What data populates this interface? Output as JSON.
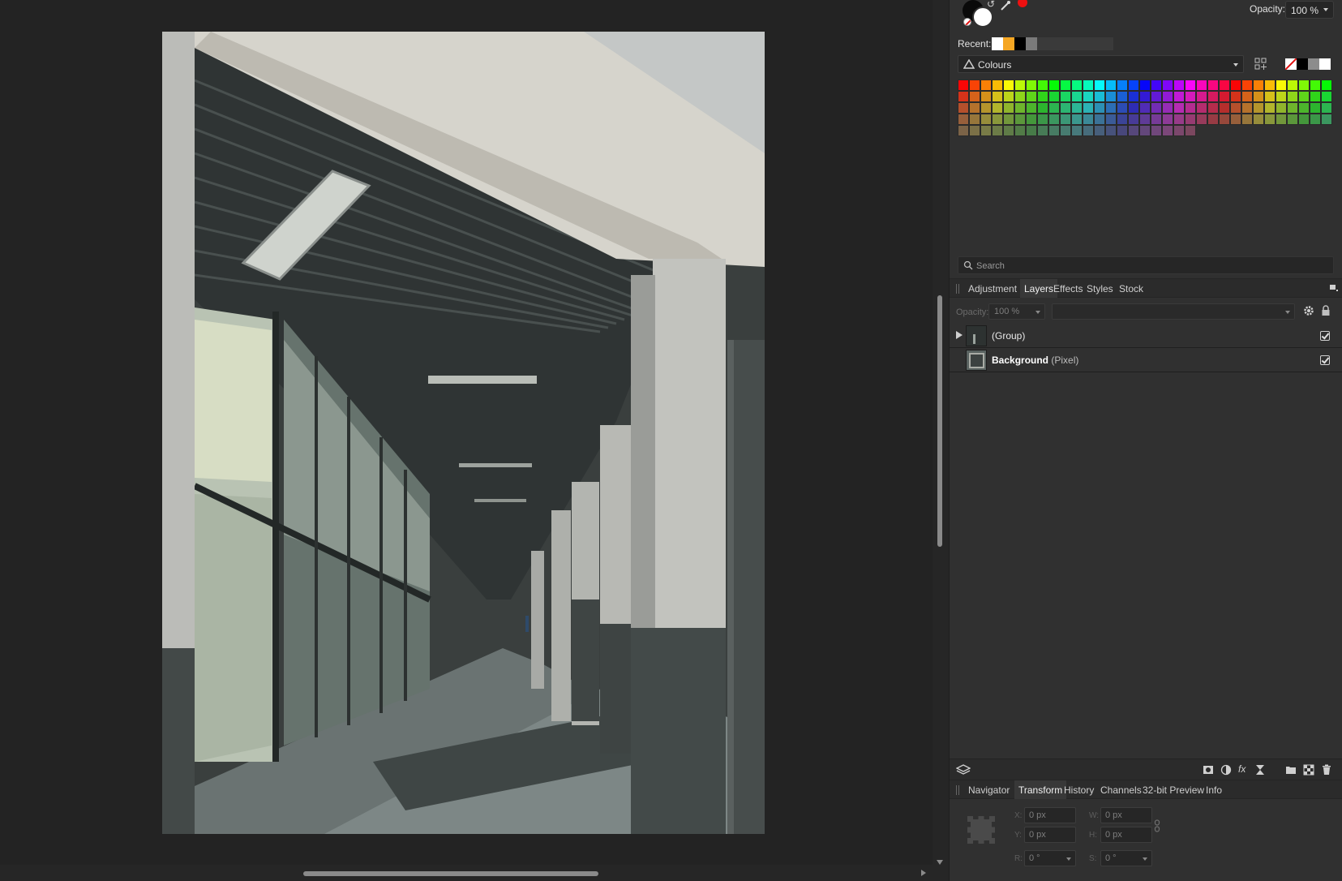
{
  "colour": {
    "opacity_label": "Opacity:",
    "opacity_value": "100 %",
    "recent_label": "Recent:",
    "recent_swatches": [
      "#ffffff",
      "#f5a623",
      "#000000",
      "#7a7a7a"
    ],
    "palette_name": "Colours",
    "primary_color": "#0a0a0a",
    "secondary_color": "#ffffff"
  },
  "search": {
    "placeholder": "Search"
  },
  "studio_tabs": {
    "items": [
      {
        "label": "Adjustment",
        "active": false
      },
      {
        "label": "Layers",
        "active": true
      },
      {
        "label": "Effects",
        "active": false
      },
      {
        "label": "Styles",
        "active": false
      },
      {
        "label": "Stock",
        "active": false
      }
    ]
  },
  "layer_options": {
    "opacity_label": "Opacity:",
    "opacity_value": "100 %"
  },
  "layers": [
    {
      "name": "(Group)",
      "type": "",
      "expandable": true,
      "visible": true
    },
    {
      "name": "Background",
      "type": "(Pixel)",
      "expandable": false,
      "visible": true
    }
  ],
  "bottom_tabs": {
    "items": [
      {
        "label": "Navigator",
        "active": false
      },
      {
        "label": "Transform",
        "active": true
      },
      {
        "label": "History",
        "active": false
      },
      {
        "label": "Channels",
        "active": false
      },
      {
        "label": "32-bit Preview",
        "active": false
      },
      {
        "label": "Info",
        "active": false
      }
    ]
  },
  "transform": {
    "x_label": "X:",
    "x_value": "0 px",
    "y_label": "Y:",
    "y_value": "0 px",
    "w_label": "W:",
    "w_value": "0 px",
    "h_label": "H:",
    "h_value": "0 px",
    "r_label": "R:",
    "r_value": "0 °",
    "s_label": "S:",
    "s_value": "0 °"
  }
}
